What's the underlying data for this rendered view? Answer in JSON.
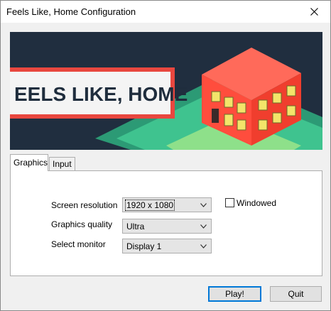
{
  "window": {
    "title": "Feels Like, Home Configuration"
  },
  "banner": {
    "logo_text": "EELS LIKE, HOME"
  },
  "tabs": [
    {
      "label": "Graphics",
      "active": true
    },
    {
      "label": "Input",
      "active": false
    }
  ],
  "graphics": {
    "screen_resolution": {
      "label": "Screen resolution",
      "value": "1920 x 1080"
    },
    "graphics_quality": {
      "label": "Graphics quality",
      "value": "Ultra"
    },
    "select_monitor": {
      "label": "Select monitor",
      "value": "Display 1"
    },
    "windowed": {
      "label": "Windowed",
      "checked": false
    }
  },
  "buttons": {
    "play": "Play!",
    "quit": "Quit"
  },
  "icons": {
    "close": "close-icon",
    "dropdown": "chevron-down-icon"
  },
  "colors": {
    "accent": "#0078d7",
    "banner_bg": "#1f2d3d",
    "house": "#ff5a4a",
    "lawn": "#3fc38f"
  }
}
